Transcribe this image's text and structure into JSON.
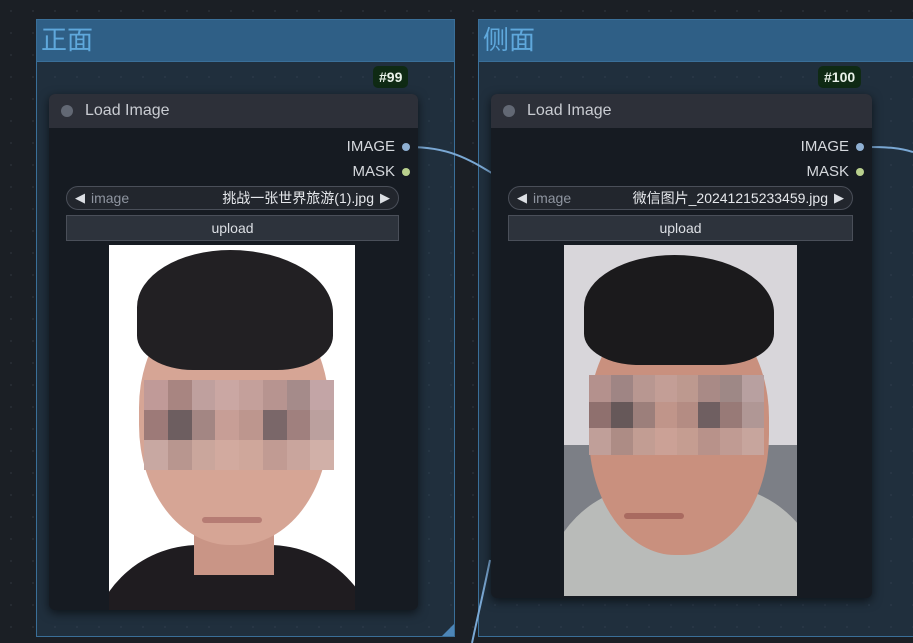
{
  "groups": [
    {
      "title": "正面"
    },
    {
      "title": "侧面"
    }
  ],
  "nodes": [
    {
      "id": "#99",
      "title": "Load Image",
      "outputs": [
        "IMAGE",
        "MASK"
      ],
      "image_widget": {
        "label": "image",
        "value": "挑战一张世界旅游(1).jpg"
      },
      "upload_label": "upload"
    },
    {
      "id": "#100",
      "title": "Load Image",
      "outputs": [
        "IMAGE",
        "MASK"
      ],
      "image_widget": {
        "label": "image",
        "value": "微信图片_20241215233459.jpg"
      },
      "upload_label": "upload"
    }
  ],
  "colors": {
    "group_header": "#2f5f86",
    "image_socket": "#8fb0d3",
    "mask_socket": "#b9d08e",
    "link": "#7aa8d4"
  }
}
